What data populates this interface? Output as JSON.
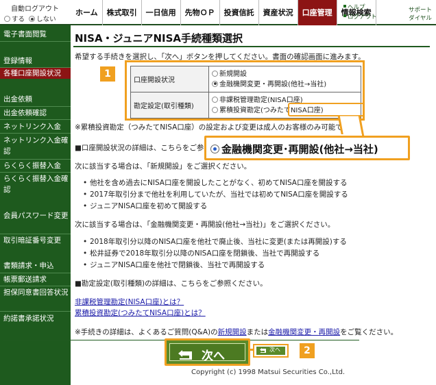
{
  "header": {
    "autologout_title": "自動ログアウト",
    "autologout_options": [
      "する",
      "しない"
    ],
    "autologout_selected": "しない",
    "nav": [
      {
        "label": "ホーム",
        "active": false
      },
      {
        "label": "株式取引",
        "active": false
      },
      {
        "label": "一日信用",
        "active": false
      },
      {
        "label": "先物ＯＰ",
        "active": false
      },
      {
        "label": "投資信託",
        "active": false
      },
      {
        "label": "資産状況",
        "active": false
      },
      {
        "label": "口座管理",
        "active": true
      },
      {
        "label": "情報検索",
        "active": false
      }
    ],
    "help": "ヘルプ",
    "logout": "ログアウト",
    "support_line1": "サポート",
    "support_line2": "ダイヤル"
  },
  "sidebar": {
    "items": [
      {
        "label": "電子書面閲覧",
        "highlight": false
      },
      {
        "label": "登録情報",
        "highlight": false
      },
      {
        "label": "各種口座開設状況",
        "highlight": true
      },
      {
        "label": "出金依頼",
        "highlight": false
      },
      {
        "label": "出金依頼確認",
        "highlight": false
      },
      {
        "label": "ネットリンク入金",
        "highlight": false
      },
      {
        "label": "ネットリンク入金確認",
        "highlight": false
      },
      {
        "label": "らくらく振替入金",
        "highlight": false
      },
      {
        "label": "らくらく振替入金確認",
        "highlight": false
      },
      {
        "label": "会員パスワード変更",
        "highlight": false
      },
      {
        "label": "取引暗証番号変更",
        "highlight": false
      },
      {
        "label": "書類請求・申込",
        "highlight": false
      },
      {
        "label": "帳票郵送請求",
        "highlight": false
      },
      {
        "label": "担保同意書回答状況",
        "highlight": false
      },
      {
        "label": "約諾書承諾状況",
        "highlight": false
      }
    ]
  },
  "main": {
    "title": "NISA・ジュニアNISA手続種類選択",
    "intro": "希望する手続きを選択し、「次へ」ボタンを押してください。書面の確認画面に進みます。",
    "table": {
      "row1_header": "口座開設状況",
      "row1_options": [
        "新規開設",
        "金融機関変更・再開設(他社→当社)"
      ],
      "row1_selected": 1,
      "row2_header": "勘定設定(取引種類)",
      "row2_options": [
        "非課税管理勘定(NISA口座)",
        "累積投資勘定(つみたてNISA口座)"
      ],
      "row2_selected": -1
    },
    "note_tsumitate": "※累積投資勘定（つみたてNISA口座）の設定および変更は成人のお客様のみ可能です。",
    "detail_status": "■口座開設状況の詳細は、こちらをご参照ください。",
    "case_new_intro": "次に該当する場合は、「新規開設」をご選択ください。",
    "case_new_items": [
      "他社を含め過去にNISA口座を開設したことがなく、初めてNISA口座を開設する",
      "2017年取引分まで他社を利用していたが、当社では初めてNISA口座を開設する",
      "ジュニアNISA口座を初めて開設する"
    ],
    "case_change_intro": "次に該当する場合は、「金融機関変更・再開設(他社→当社)」をご選択ください。",
    "case_change_items": [
      "2018年取引分以降のNISA口座を他社で廃止後、当社に変更(または再開設)する",
      "松井証券で2018年取引分以降のNISA口座を閉鎖後、当社で再開設する",
      "ジュニアNISA口座を他社で閉鎖後、当社で再開設する"
    ],
    "detail_account": "■勘定設定(取引種類)の詳細は、こちらをご参照ください。",
    "link_nisa": "非課税管理勘定(NISA口座)とは？",
    "link_tsumitate": "累積投資勘定(つみたてNISA口座)とは？",
    "faq_prefix": "※手続きの詳細は、よくあるご質問(Q&A)の",
    "faq_link1": "新規開設",
    "faq_mid": "または",
    "faq_link2": "金融機関変更・再開設",
    "faq_suffix": "をご覧ください。",
    "copyright": "Copyright (c) 1998 Matsui Securities Co.,Ltd."
  },
  "annotations": {
    "badge1": "1",
    "badge2": "2",
    "callout_text": "金融機関変更･再開設(他社→当社)",
    "next_big": "次へ",
    "next_small": "次へ"
  },
  "colors": {
    "sidebar_bg": "#1e5a1e",
    "active_red": "#8c1414",
    "highlight_orange": "#f0a020",
    "button_green": "#5a8a2a",
    "link_blue": "#1a1aa8"
  }
}
